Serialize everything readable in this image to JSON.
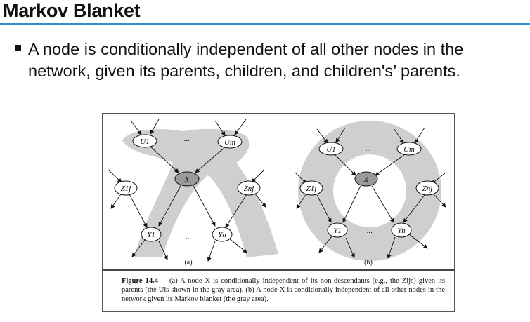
{
  "slide": {
    "title": "Markov Blanket",
    "bullet": "A node is conditionally independent of all other nodes in the network, given its parents, children, and children's’ parents."
  },
  "figure": {
    "panel_a_label": "(a)",
    "panel_b_label": "(b)",
    "nodes": {
      "u1": "U1",
      "um": "Um",
      "x": "X",
      "z1j": "Z1j",
      "znj": "Znj",
      "y1": "Y1",
      "yn": "Yn"
    },
    "ellipsis": "...",
    "caption_label": "Figure 14.4",
    "caption_text": "(a) A node X is conditionally independent of its non-descendants (e.g., the Zijs) given its parents (the Uis shown in the gray area). (b) A node X is conditionally independent of all other nodes in the network given its Markov blanket (the gray area).",
    "colors": {
      "shade": "#cfcfcf",
      "node_fill": "#ffffff",
      "x_fill": "#9a9a9a",
      "accent_rule": "#2f8fd0"
    }
  }
}
